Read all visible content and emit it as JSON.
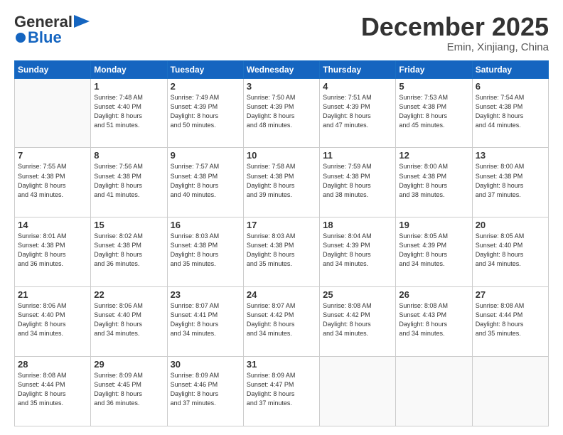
{
  "header": {
    "logo_line1": "General",
    "logo_line2": "Blue",
    "month": "December 2025",
    "location": "Emin, Xinjiang, China"
  },
  "days_of_week": [
    "Sunday",
    "Monday",
    "Tuesday",
    "Wednesday",
    "Thursday",
    "Friday",
    "Saturday"
  ],
  "weeks": [
    [
      {
        "day": "",
        "info": ""
      },
      {
        "day": "1",
        "info": "Sunrise: 7:48 AM\nSunset: 4:40 PM\nDaylight: 8 hours\nand 51 minutes."
      },
      {
        "day": "2",
        "info": "Sunrise: 7:49 AM\nSunset: 4:39 PM\nDaylight: 8 hours\nand 50 minutes."
      },
      {
        "day": "3",
        "info": "Sunrise: 7:50 AM\nSunset: 4:39 PM\nDaylight: 8 hours\nand 48 minutes."
      },
      {
        "day": "4",
        "info": "Sunrise: 7:51 AM\nSunset: 4:39 PM\nDaylight: 8 hours\nand 47 minutes."
      },
      {
        "day": "5",
        "info": "Sunrise: 7:53 AM\nSunset: 4:38 PM\nDaylight: 8 hours\nand 45 minutes."
      },
      {
        "day": "6",
        "info": "Sunrise: 7:54 AM\nSunset: 4:38 PM\nDaylight: 8 hours\nand 44 minutes."
      }
    ],
    [
      {
        "day": "7",
        "info": "Sunrise: 7:55 AM\nSunset: 4:38 PM\nDaylight: 8 hours\nand 43 minutes."
      },
      {
        "day": "8",
        "info": "Sunrise: 7:56 AM\nSunset: 4:38 PM\nDaylight: 8 hours\nand 41 minutes."
      },
      {
        "day": "9",
        "info": "Sunrise: 7:57 AM\nSunset: 4:38 PM\nDaylight: 8 hours\nand 40 minutes."
      },
      {
        "day": "10",
        "info": "Sunrise: 7:58 AM\nSunset: 4:38 PM\nDaylight: 8 hours\nand 39 minutes."
      },
      {
        "day": "11",
        "info": "Sunrise: 7:59 AM\nSunset: 4:38 PM\nDaylight: 8 hours\nand 38 minutes."
      },
      {
        "day": "12",
        "info": "Sunrise: 8:00 AM\nSunset: 4:38 PM\nDaylight: 8 hours\nand 38 minutes."
      },
      {
        "day": "13",
        "info": "Sunrise: 8:00 AM\nSunset: 4:38 PM\nDaylight: 8 hours\nand 37 minutes."
      }
    ],
    [
      {
        "day": "14",
        "info": "Sunrise: 8:01 AM\nSunset: 4:38 PM\nDaylight: 8 hours\nand 36 minutes."
      },
      {
        "day": "15",
        "info": "Sunrise: 8:02 AM\nSunset: 4:38 PM\nDaylight: 8 hours\nand 36 minutes."
      },
      {
        "day": "16",
        "info": "Sunrise: 8:03 AM\nSunset: 4:38 PM\nDaylight: 8 hours\nand 35 minutes."
      },
      {
        "day": "17",
        "info": "Sunrise: 8:03 AM\nSunset: 4:38 PM\nDaylight: 8 hours\nand 35 minutes."
      },
      {
        "day": "18",
        "info": "Sunrise: 8:04 AM\nSunset: 4:39 PM\nDaylight: 8 hours\nand 34 minutes."
      },
      {
        "day": "19",
        "info": "Sunrise: 8:05 AM\nSunset: 4:39 PM\nDaylight: 8 hours\nand 34 minutes."
      },
      {
        "day": "20",
        "info": "Sunrise: 8:05 AM\nSunset: 4:40 PM\nDaylight: 8 hours\nand 34 minutes."
      }
    ],
    [
      {
        "day": "21",
        "info": "Sunrise: 8:06 AM\nSunset: 4:40 PM\nDaylight: 8 hours\nand 34 minutes."
      },
      {
        "day": "22",
        "info": "Sunrise: 8:06 AM\nSunset: 4:40 PM\nDaylight: 8 hours\nand 34 minutes."
      },
      {
        "day": "23",
        "info": "Sunrise: 8:07 AM\nSunset: 4:41 PM\nDaylight: 8 hours\nand 34 minutes."
      },
      {
        "day": "24",
        "info": "Sunrise: 8:07 AM\nSunset: 4:42 PM\nDaylight: 8 hours\nand 34 minutes."
      },
      {
        "day": "25",
        "info": "Sunrise: 8:08 AM\nSunset: 4:42 PM\nDaylight: 8 hours\nand 34 minutes."
      },
      {
        "day": "26",
        "info": "Sunrise: 8:08 AM\nSunset: 4:43 PM\nDaylight: 8 hours\nand 34 minutes."
      },
      {
        "day": "27",
        "info": "Sunrise: 8:08 AM\nSunset: 4:44 PM\nDaylight: 8 hours\nand 35 minutes."
      }
    ],
    [
      {
        "day": "28",
        "info": "Sunrise: 8:08 AM\nSunset: 4:44 PM\nDaylight: 8 hours\nand 35 minutes."
      },
      {
        "day": "29",
        "info": "Sunrise: 8:09 AM\nSunset: 4:45 PM\nDaylight: 8 hours\nand 36 minutes."
      },
      {
        "day": "30",
        "info": "Sunrise: 8:09 AM\nSunset: 4:46 PM\nDaylight: 8 hours\nand 37 minutes."
      },
      {
        "day": "31",
        "info": "Sunrise: 8:09 AM\nSunset: 4:47 PM\nDaylight: 8 hours\nand 37 minutes."
      },
      {
        "day": "",
        "info": ""
      },
      {
        "day": "",
        "info": ""
      },
      {
        "day": "",
        "info": ""
      }
    ]
  ]
}
